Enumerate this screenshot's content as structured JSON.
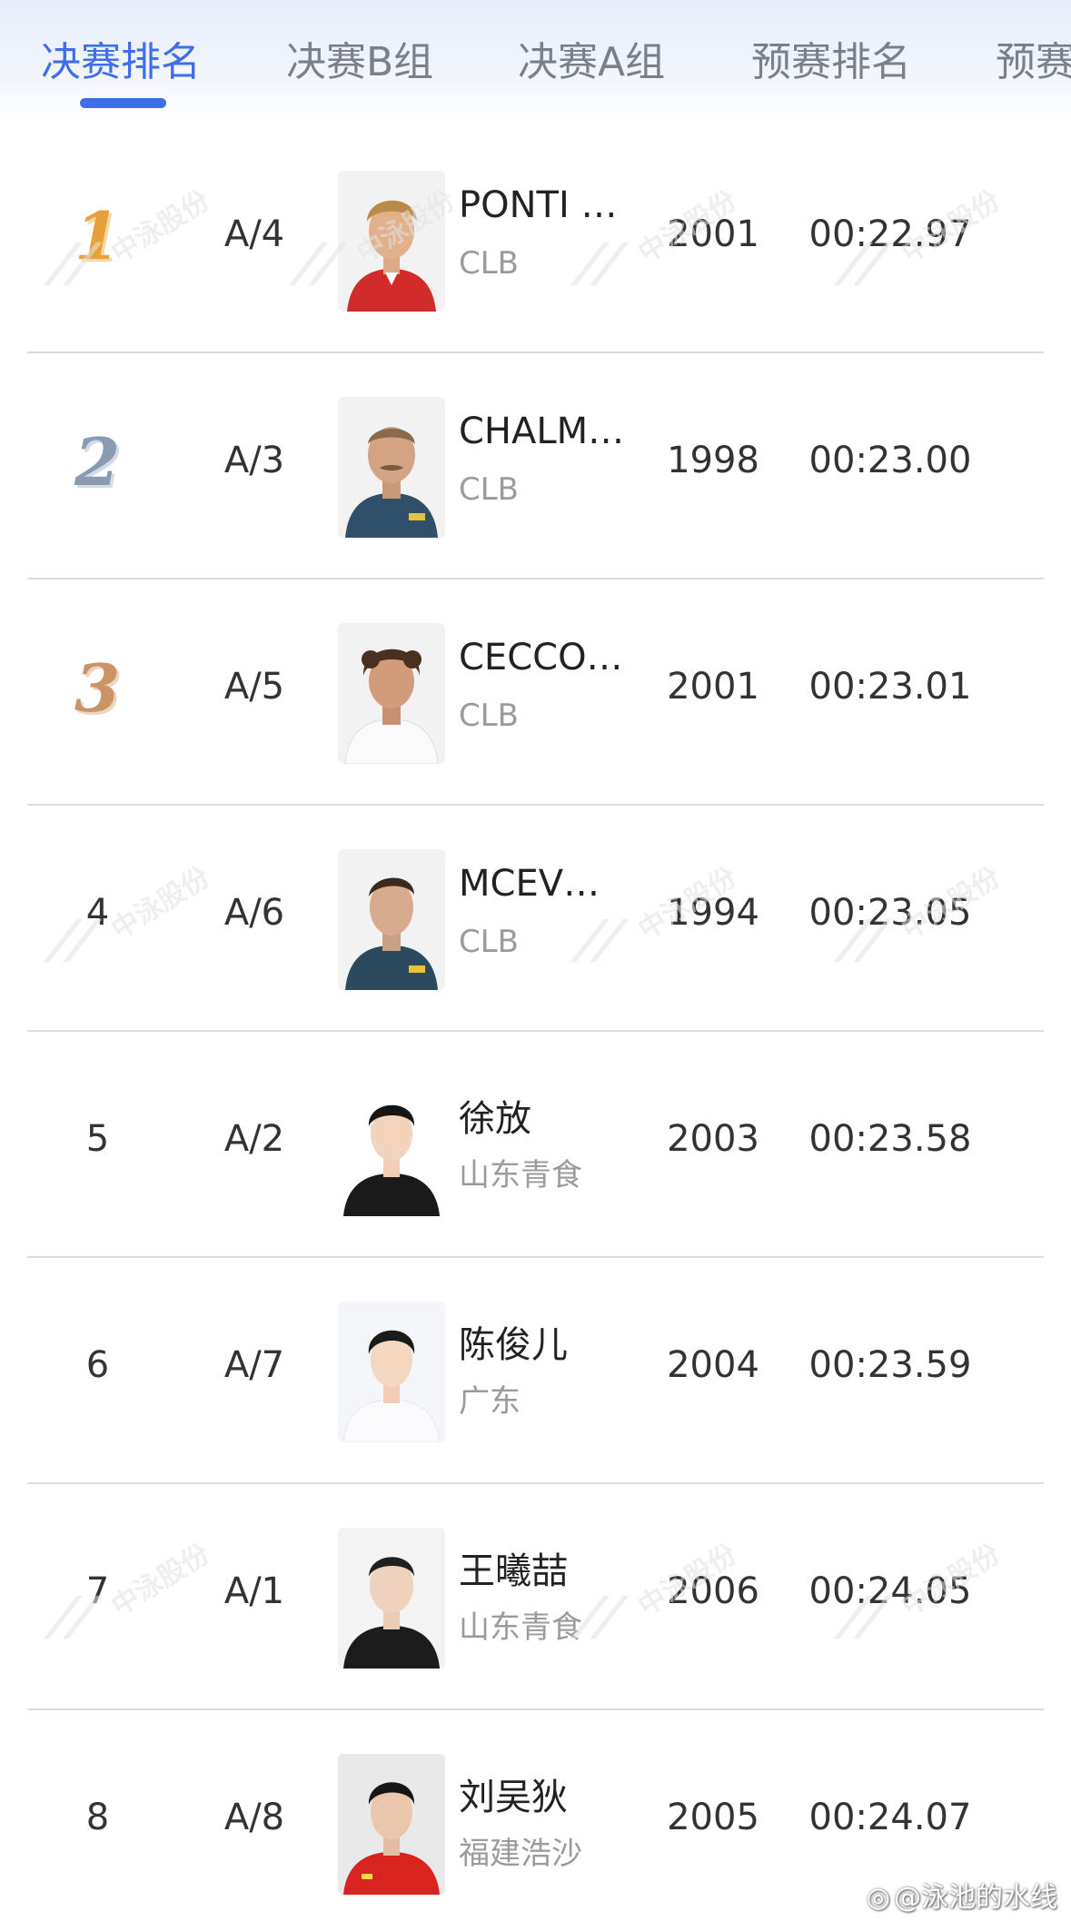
{
  "tabs": [
    {
      "label": "决赛排名",
      "active": true
    },
    {
      "label": "决赛B组",
      "active": false
    },
    {
      "label": "决赛A组",
      "active": false
    },
    {
      "label": "预赛排名",
      "active": false
    },
    {
      "label": "预赛",
      "active": false
    }
  ],
  "accent_color": "#3f6ee8",
  "watermark": {
    "text": "中泳股份"
  },
  "weibo_watermark": "@泳池的水线",
  "rows": [
    {
      "rank": "1",
      "medal": "gold",
      "lane": "A/4",
      "name": "PONTI …",
      "team": "CLB",
      "year": "2001",
      "time": "00:22.97"
    },
    {
      "rank": "2",
      "medal": "silver",
      "lane": "A/3",
      "name": "CHALM…",
      "team": "CLB",
      "year": "1998",
      "time": "00:23.00"
    },
    {
      "rank": "3",
      "medal": "bronze",
      "lane": "A/5",
      "name": "CECCO…",
      "team": "CLB",
      "year": "2001",
      "time": "00:23.01"
    },
    {
      "rank": "4",
      "medal": "",
      "lane": "A/6",
      "name": "MCEV…",
      "team": "CLB",
      "year": "1994",
      "time": "00:23.05"
    },
    {
      "rank": "5",
      "medal": "",
      "lane": "A/2",
      "name": "徐放",
      "team": "山东青食",
      "year": "2003",
      "time": "00:23.58"
    },
    {
      "rank": "6",
      "medal": "",
      "lane": "A/7",
      "name": "陈俊儿",
      "team": "广东",
      "year": "2004",
      "time": "00:23.59"
    },
    {
      "rank": "7",
      "medal": "",
      "lane": "A/1",
      "name": "王曦喆",
      "team": "山东青食",
      "year": "2006",
      "time": "00:24.05"
    },
    {
      "rank": "8",
      "medal": "",
      "lane": "A/8",
      "name": "刘吴狄",
      "team": "福建浩沙",
      "year": "2005",
      "time": "00:24.07"
    }
  ]
}
